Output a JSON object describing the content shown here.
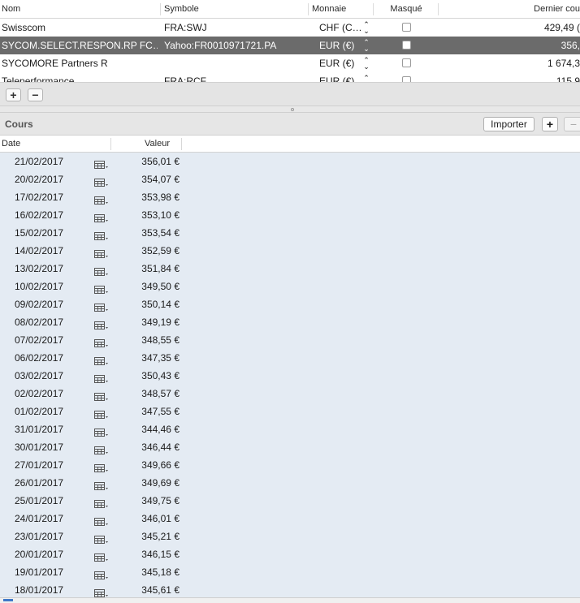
{
  "securities_table": {
    "columns": [
      "Nom",
      "Symbole",
      "Monnaie",
      "Masqué",
      "Dernier cou"
    ],
    "rows": [
      {
        "nom": "Swisscom",
        "symbole": "FRA:SWJ",
        "monnaie": "CHF (C…",
        "masque": false,
        "dernier": "429,49 (",
        "selected": false
      },
      {
        "nom": "SYCOM.SELECT.RESPON.RP FC…",
        "symbole": "Yahoo:FR0010971721.PA",
        "monnaie": "EUR (€)",
        "masque": false,
        "dernier": "356,",
        "selected": true
      },
      {
        "nom": "SYCOMORE Partners R",
        "symbole": "",
        "monnaie": "EUR (€)",
        "masque": false,
        "dernier": "1 674,3",
        "selected": false
      },
      {
        "nom": "Teleperformance",
        "symbole": "FRA:RCF",
        "monnaie": "EUR (€)",
        "masque": false,
        "dernier": "115,9",
        "selected": false
      }
    ]
  },
  "toolbar": {
    "add_label": "+",
    "remove_label": "−"
  },
  "cours": {
    "title": "Cours",
    "import_label": "Importer",
    "add_label": "+",
    "remove_label": "−",
    "columns": [
      "Date",
      "Valeur"
    ],
    "quotes": [
      {
        "date": "21/02/2017",
        "valeur": "356,01 €"
      },
      {
        "date": "20/02/2017",
        "valeur": "354,07 €"
      },
      {
        "date": "17/02/2017",
        "valeur": "353,98 €"
      },
      {
        "date": "16/02/2017",
        "valeur": "353,10 €"
      },
      {
        "date": "15/02/2017",
        "valeur": "353,54 €"
      },
      {
        "date": "14/02/2017",
        "valeur": "352,59 €"
      },
      {
        "date": "13/02/2017",
        "valeur": "351,84 €"
      },
      {
        "date": "10/02/2017",
        "valeur": "349,50 €"
      },
      {
        "date": "09/02/2017",
        "valeur": "350,14 €"
      },
      {
        "date": "08/02/2017",
        "valeur": "349,19 €"
      },
      {
        "date": "07/02/2017",
        "valeur": "348,55 €"
      },
      {
        "date": "06/02/2017",
        "valeur": "347,35 €"
      },
      {
        "date": "03/02/2017",
        "valeur": "350,43 €"
      },
      {
        "date": "02/02/2017",
        "valeur": "348,57 €"
      },
      {
        "date": "01/02/2017",
        "valeur": "347,55 €"
      },
      {
        "date": "31/01/2017",
        "valeur": "344,46 €"
      },
      {
        "date": "30/01/2017",
        "valeur": "346,44 €"
      },
      {
        "date": "27/01/2017",
        "valeur": "349,66 €"
      },
      {
        "date": "26/01/2017",
        "valeur": "349,69 €"
      },
      {
        "date": "25/01/2017",
        "valeur": "349,75 €"
      },
      {
        "date": "24/01/2017",
        "valeur": "346,01 €"
      },
      {
        "date": "23/01/2017",
        "valeur": "345,21 €"
      },
      {
        "date": "20/01/2017",
        "valeur": "346,15 €"
      },
      {
        "date": "19/01/2017",
        "valeur": "345,18 €"
      },
      {
        "date": "18/01/2017",
        "valeur": "345,61 €"
      }
    ]
  },
  "icons": {
    "calendar": "calendar-picker-icon",
    "stepper": "up-down-stepper-icon"
  },
  "colors": {
    "selected_row": "#6b6b6b",
    "quotes_background": "#e4ebf3"
  }
}
